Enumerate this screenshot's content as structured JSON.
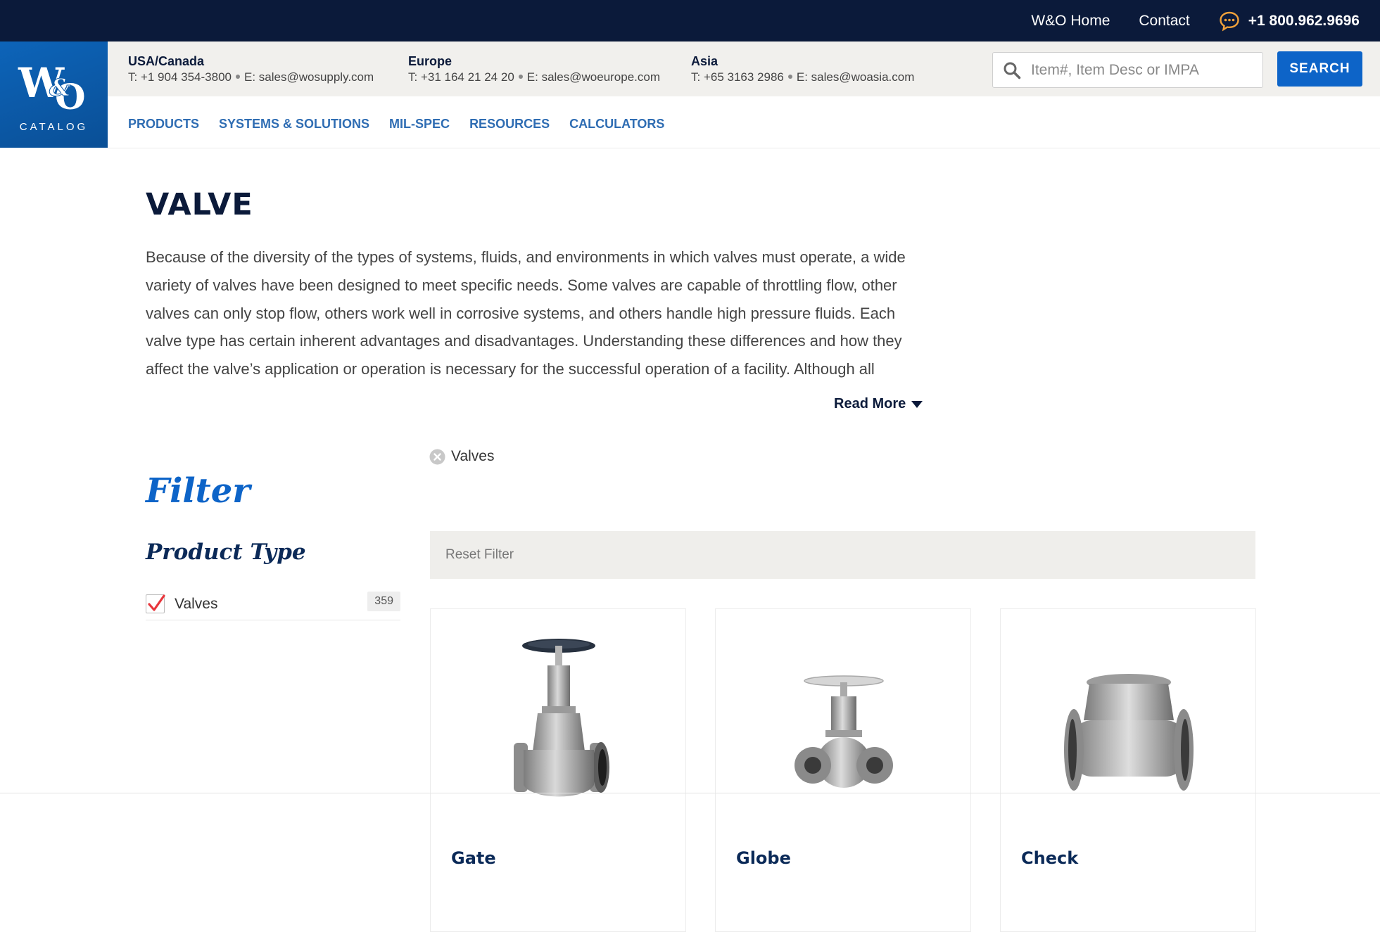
{
  "topbar": {
    "home_link": "W&O Home",
    "contact_link": "Contact",
    "phone": "+1 800.962.9696",
    "icon": "chat-bubble-icon",
    "bg_color": "#0b1a3a",
    "icon_color": "#f2a23a"
  },
  "logo": {
    "mark": "W&O",
    "subtitle": "CATALOG",
    "bg_color": "#0d64b9"
  },
  "contacts": [
    {
      "region": "USA/Canada",
      "phone": "T:  +1 904 354-3800",
      "email": "E:  sales@wosupply.com"
    },
    {
      "region": "Europe",
      "phone": "T: +31 164 21 24 20",
      "email": "E:  sales@woeurope.com"
    },
    {
      "region": "Asia",
      "phone": "T:  +65 3163 2986",
      "email": "E:  sales@woasia.com"
    }
  ],
  "search": {
    "placeholder": "Item#, Item Desc or IMPA",
    "value": "",
    "button_label": "SEARCH",
    "accent": "#0d64c8"
  },
  "nav": {
    "items": [
      "PRODUCTS",
      "SYSTEMS & SOLUTIONS",
      "MIL-SPEC",
      "RESOURCES",
      "CALCULATORS"
    ],
    "color": "#2f6db3"
  },
  "page": {
    "title": "VALVE",
    "description": "Because of the diversity of the types of systems, fluids, and environments in which valves must operate, a wide variety of valves have been designed to meet specific needs. Some valves are capable of throttling flow, other valves can only stop flow, others work well in corrosive systems, and others handle high pressure fluids. Each valve type has certain inherent advantages and disadvantages. Understanding these differences and how they affect the valve’s application or operation is necessary for the successful operation of a facility. Although all",
    "read_more": "Read More"
  },
  "filter": {
    "title": "Filter",
    "active_chip": "Valves",
    "product_type_heading": "Product Type",
    "facets": [
      {
        "label": "Valves",
        "count": "359",
        "checked": true
      }
    ],
    "reset_label": "Reset Filter"
  },
  "products": [
    {
      "title": "Gate",
      "image_icon": "gate-valve-image"
    },
    {
      "title": "Globe",
      "image_icon": "globe-valve-image"
    },
    {
      "title": "Check",
      "image_icon": "check-valve-image"
    }
  ]
}
